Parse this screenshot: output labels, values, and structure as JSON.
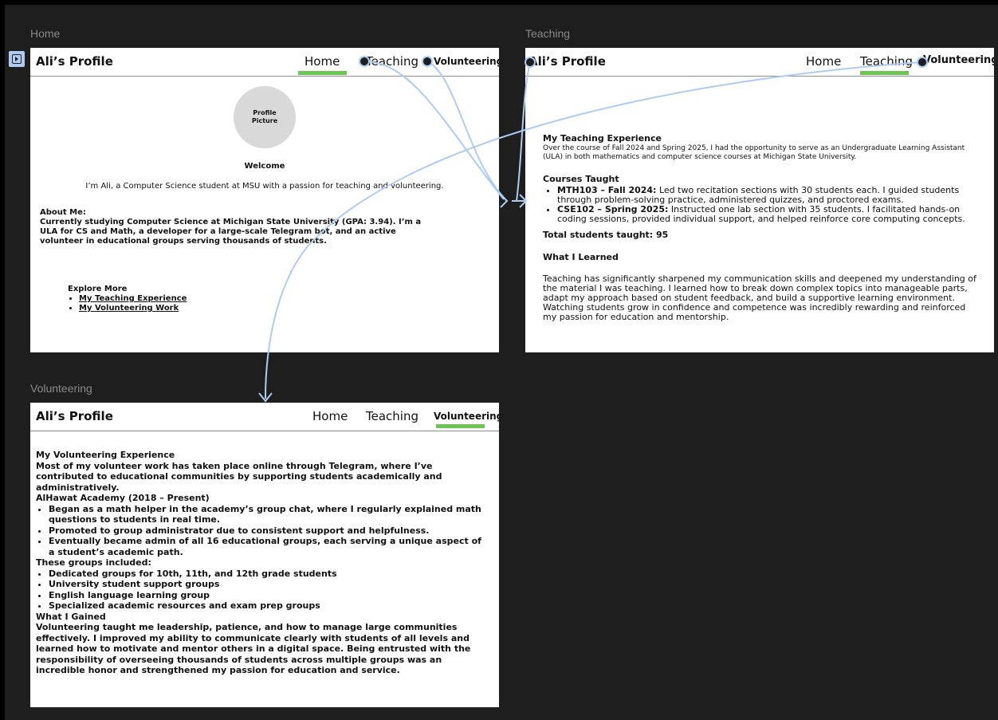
{
  "frames": {
    "home": {
      "label": "Home",
      "brand": "Ali’s Profile",
      "nav": [
        "Home",
        "Teaching",
        "Volunteering"
      ],
      "avatar": "Profile\nPicture",
      "welcome": "Welcome",
      "intro": "I’m Ali, a Computer Science student at MSU with a passion for teaching and volunteering.",
      "about_heading": "About Me:",
      "about_text": "Currently studying Computer Science at Michigan State University (GPA: 3.94). I’m a ULA for CS and Math, a developer for a large-scale Telegram bot, and an active volunteer in educational groups serving thousands of students.",
      "explore_heading": "Explore More",
      "links": [
        "My Teaching Experience",
        "My Volunteering Work"
      ]
    },
    "teaching": {
      "label": "Teaching",
      "brand": "Ali’s Profile",
      "nav": [
        "Home",
        "Teaching",
        "Volunteering"
      ],
      "exp_heading": "My Teaching Experience",
      "exp_text": "Over the course of Fall 2024 and Spring 2025, I had the opportunity to serve as an Undergraduate Learning Assistant (ULA) in both mathematics and computer science courses at Michigan State University.",
      "courses_heading": "Courses Taught",
      "courses": [
        {
          "title": "MTH103 – Fall 2024:",
          "text": "Led two recitation sections with 30 students each. I guided students through problem-solving practice, administered quizzes, and proctored exams."
        },
        {
          "title": "CSE102 – Spring 2025:",
          "text": "Instructed one lab section with 35 students. I facilitated hands-on coding sessions, provided individual support, and helped reinforce core computing concepts."
        }
      ],
      "total": "Total students taught: 95",
      "learned_heading": "What I Learned",
      "learned_text": "Teaching has significantly sharpened my communication skills and deepened my understanding of the material I was teaching. I learned how to break down complex topics into manageable parts, adapt my approach based on student feedback, and build a supportive learning environment. Watching students grow in confidence and competence was incredibly rewarding and reinforced my passion for education and mentorship."
    },
    "volunteering": {
      "label": "Volunteering",
      "brand": "Ali’s Profile",
      "nav": [
        "Home",
        "Teaching",
        "Volunteering"
      ],
      "heading": "My Volunteering Experience",
      "intro": "Most of my volunteer work has taken place online through Telegram, where I’ve contributed to educational communities by supporting students academically and administratively.",
      "academy_heading": "AlHawat Academy (2018 – Present)",
      "academy_items": [
        "Began as a math helper in the academy’s group chat, where I regularly explained math questions to students in real time.",
        "Promoted to group administrator due to consistent support and helpfulness.",
        "Eventually became admin of all 16 educational groups, each serving a unique aspect of a student’s academic path."
      ],
      "groups_heading": "These groups included:",
      "groups": [
        "Dedicated groups for 10th, 11th, and 12th grade students",
        "University student support groups",
        "English language learning group",
        "Specialized academic resources and exam prep groups"
      ],
      "gained_heading": "What I Gained",
      "gained_text": "Volunteering taught me leadership, patience, and how to manage large communities effectively. I improved my ability to communicate clearly with students of all levels and learned how to motivate and mentor others in a digital space. Being entrusted with the responsibility of overseeing thousands of students across multiple groups was an incredible honor and strengthened my passion for education and service."
    }
  },
  "colors": {
    "canvas": "#1e1e1e",
    "active_underline": "#6cc552",
    "connector": "#aecbf2"
  },
  "icons": {
    "prototype": "play-frame-icon"
  }
}
